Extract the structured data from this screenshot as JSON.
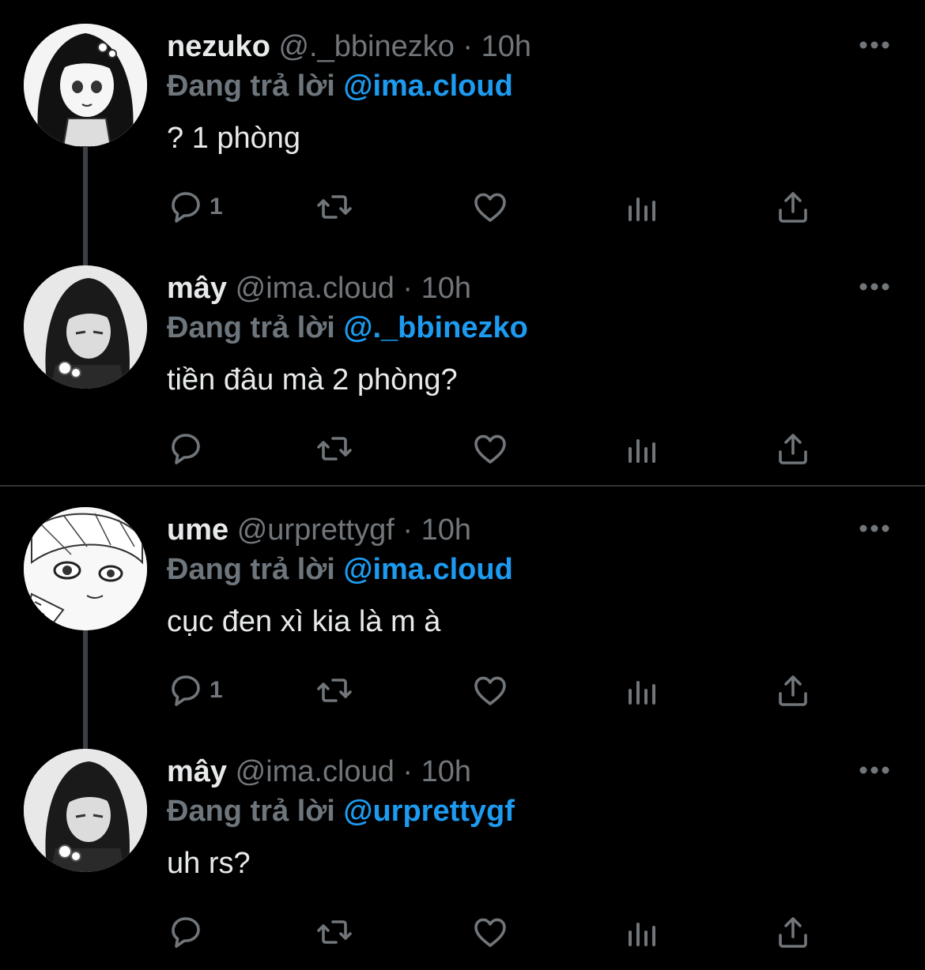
{
  "colors": {
    "background": "#000000",
    "text": "#e7e9ea",
    "muted": "#71767b",
    "mention": "#1d9bf0",
    "thread_line": "#3b4046"
  },
  "tweets": [
    {
      "name": "nezuko",
      "handle": "@._bbinezko",
      "dot": "·",
      "time": "10h",
      "reply_prefix": "Đang trả lời",
      "reply_to": "@ima.cloud",
      "text": "? 1 phòng",
      "reply_count": "1",
      "avatar": "nezuko-avatar"
    },
    {
      "name": "mây",
      "handle": "@ima.cloud",
      "dot": "·",
      "time": "10h",
      "reply_prefix": "Đang trả lời",
      "reply_to": "@._bbinezko",
      "text": "tiền đâu mà 2 phòng?",
      "reply_count": "",
      "avatar": "may-avatar"
    },
    {
      "name": "ume",
      "handle": "@urprettygf",
      "dot": "·",
      "time": "10h",
      "reply_prefix": "Đang trả lời",
      "reply_to": "@ima.cloud",
      "text": "cục đen xì kia là m à",
      "reply_count": "1",
      "avatar": "ume-avatar"
    },
    {
      "name": "mây",
      "handle": "@ima.cloud",
      "dot": "·",
      "time": "10h",
      "reply_prefix": "Đang trả lời",
      "reply_to": "@urprettygf",
      "text": "uh rs?",
      "reply_count": "",
      "avatar": "may-avatar"
    }
  ],
  "icons": {
    "reply": "reply-icon",
    "retweet": "retweet-icon",
    "like": "heart-icon",
    "analytics": "analytics-icon",
    "share": "share-icon",
    "more": "more-icon"
  }
}
